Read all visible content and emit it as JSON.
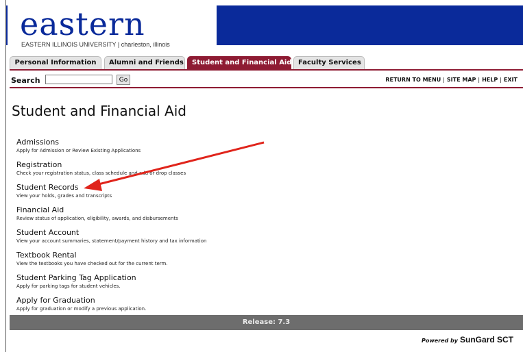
{
  "header": {
    "logo_text": "eastern",
    "logo_subtitle": "EASTERN ILLINOIS UNIVERSITY | charleston, illinois"
  },
  "tabs": [
    {
      "label": "Personal Information",
      "active": false
    },
    {
      "label": "Alumni and Friends",
      "active": false
    },
    {
      "label": "Student and Financial Aid",
      "active": true
    },
    {
      "label": "Faculty Services",
      "active": false
    }
  ],
  "search": {
    "label": "Search",
    "value": "",
    "button_label": "Go"
  },
  "util_links": {
    "menu": "RETURN TO MENU",
    "site_map": "SITE MAP",
    "help": "HELP",
    "exit": "EXIT"
  },
  "page_title": "Student and Financial Aid",
  "menu_items": [
    {
      "label": "Admissions",
      "description": "Apply for Admission or Review Existing Applications"
    },
    {
      "label": "Registration",
      "description": "Check your registration status, class schedule and add or drop classes"
    },
    {
      "label": "Student Records",
      "description": "View your holds, grades and transcripts"
    },
    {
      "label": "Financial Aid",
      "description": "Review status of application, eligibility, awards, and disbursements"
    },
    {
      "label": "Student Account",
      "description": "View your account summaries, statement/payment history and tax information"
    },
    {
      "label": "Textbook Rental",
      "description": "View the textbooks you have checked out for the current term."
    },
    {
      "label": "Student Parking Tag Application",
      "description": "Apply for parking tags for student vehicles."
    },
    {
      "label": "Apply for Graduation",
      "description": "Apply for graduation or modify a previous application."
    }
  ],
  "release": "Release: 7.3",
  "powered_by": {
    "prefix": "Powered by",
    "brand": "SunGard SCT"
  },
  "colors": {
    "header_blue": "#0a2a9a",
    "tab_active": "#8e1b33",
    "annotation_arrow": "#e0241b"
  }
}
